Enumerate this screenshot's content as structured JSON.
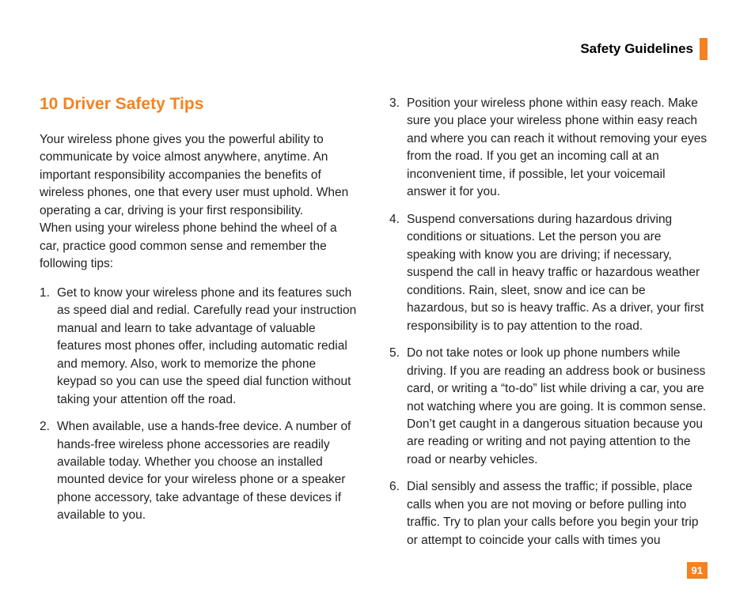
{
  "header": {
    "title": "Safety Guidelines"
  },
  "section": {
    "title": "10 Driver Safety Tips",
    "intro": "Your wireless phone gives you the powerful ability to communicate by voice almost anywhere, anytime. An important responsibility accompanies the benefits of wireless phones, one that every user must uphold. When operating a car, driving is your first responsibility.\nWhen using your wireless phone behind the wheel of a car, practice good common sense and remember the following tips:",
    "tips": [
      "Get to know your wireless phone and its features such as speed dial and redial. Carefully read your instruction manual and learn to take advantage of valuable features most phones offer, including automatic redial and memory. Also, work to memorize the phone keypad so you can use the speed dial function without taking your attention off the road.",
      "When available, use a hands-free device. A number of hands-free wireless phone accessories are readily available today. Whether you choose an installed mounted device for your wireless phone or a speaker phone accessory, take advantage of these devices if available to you.",
      "Position your wireless phone within easy reach. Make sure you place your wireless phone within easy reach and where you can reach it without removing your eyes from the road. If you get an incoming call at an inconvenient time, if possible, let your voicemail answer it for you.",
      "Suspend conversations during hazardous driving conditions or situations. Let the person you are speaking with know you are driving; if necessary, suspend the call in heavy traffic or hazardous weather conditions. Rain, sleet, snow and ice can be hazardous, but so is heavy traffic. As a driver, your first responsibility is to pay attention to the road.",
      "Do not take notes or look up phone numbers while driving. If you are reading an address book or business card, or writing a “to-do” list while driving a car, you are not watching where you are going. It is common sense. Don’t get caught in a dangerous situation because you are reading or writing and not paying attention to the road or nearby vehicles.",
      "Dial sensibly and assess the traffic; if possible, place calls when you are not moving or before pulling into traffic. Try to plan your calls before you begin your trip or attempt to coincide your calls with times you"
    ]
  },
  "pageNumber": "91"
}
